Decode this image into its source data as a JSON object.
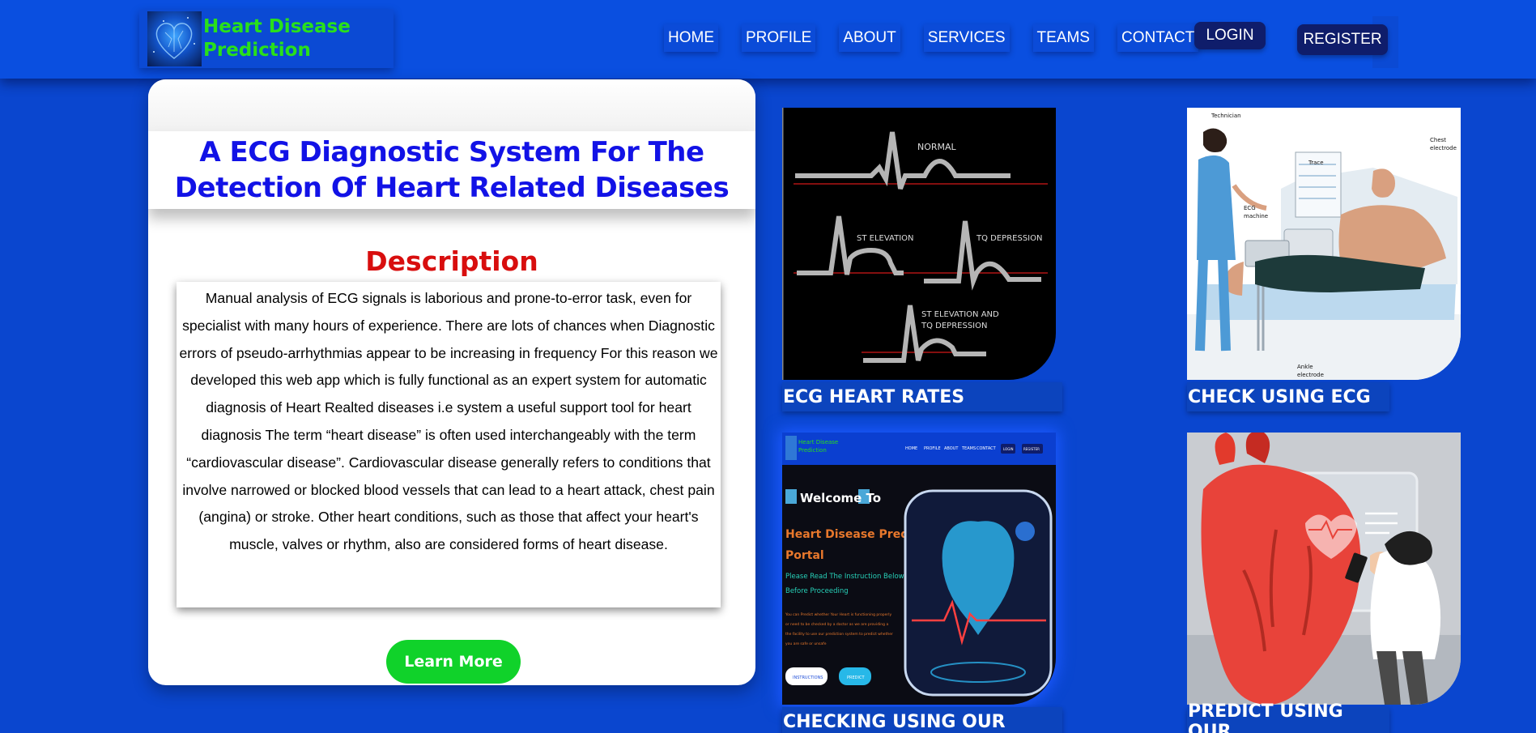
{
  "brand": {
    "title_line1": "Heart Disease",
    "title_line2": "Prediction",
    "logo_icon": "heart-logo-icon"
  },
  "nav": {
    "items": [
      "HOME",
      "PROFILE",
      "ABOUT",
      "SERVICES",
      "TEAMS",
      "CONTACT"
    ],
    "login_label": "LOGIN",
    "register_label": "REGISTER"
  },
  "main": {
    "headline_line1": "A ECG Diagnostic System For The",
    "headline_line2": "Detection Of Heart Related Diseases",
    "description_title": "Description",
    "description_text": "Manual analysis of ECG signals is laborious and prone-to-error task, even for specialist with many hours of experience. There are lots of chances when Diagnostic errors of pseudo-arrhythmias appear to be increasing in frequency For this reason we developed this web app which is fully functional as an expert system for automatic diagnosis of Heart Realted diseases i.e system a useful support tool for heart diagnosis The term “heart disease” is often used interchangeably with the term “cardiovascular disease”. Cardiovascular disease generally refers to conditions that involve narrowed or blocked blood vessels that can lead to a heart attack, chest pain (angina) or stroke. Other heart conditions, such as those that affect your heart's muscle, valves or rhythm, also are considered forms of heart disease.",
    "learn_more_label": "Learn More"
  },
  "tiles": [
    {
      "label": "ECG HEART RATES",
      "image": {
        "normal": "NORMAL",
        "st": "ST ELEVATION",
        "tq": "TQ DEPRESSION",
        "st_tq_1": "ST ELEVATION AND",
        "st_tq_2": "TQ DEPRESSION"
      }
    },
    {
      "label": "CHECK USING ECG",
      "image": {
        "technician": "Technician",
        "trace": "Trace",
        "chest_1": "Chest",
        "chest_2": "electrode",
        "ecg_1": "ECG",
        "ecg_2": "machine",
        "ankle_1": "Ankle",
        "ankle_2": "electrode"
      }
    },
    {
      "label": "CHECKING USING OUR",
      "image": {
        "brand_1": "Heart Disease",
        "brand_2": "Prediction",
        "nav": [
          "HOME",
          "PROFILE",
          "ABOUT",
          "TEAMS",
          "CONTACT"
        ],
        "login": "LOGIN",
        "register": "REGISTER",
        "welcome": "Welcome To",
        "portal_1": "Heart Disease Prediction",
        "portal_2": "Portal",
        "instr_1": "Please Read The Instruction Below Carefully",
        "instr_2": "Before Proceeding",
        "body_1": "You can Predict whether Your Heart is functioning properly",
        "body_2": "or need to be checked by a doctor as we are providing a",
        "body_3": "the facility to use our prediction system to predict whether",
        "body_4": "you are safe or unsafe",
        "btn_instructions": "INSTRUCTIONS",
        "btn_predict": "PREDICT"
      }
    },
    {
      "label": "PREDICT USING OUR",
      "image": {}
    }
  ],
  "colors": {
    "page_bg": "#0a46cf",
    "brand_green": "#29e01b",
    "headline_blue": "#1212e6",
    "description_red": "#d80e0e",
    "button_green": "#10d22a",
    "nav_button": "#0f1d6b"
  }
}
